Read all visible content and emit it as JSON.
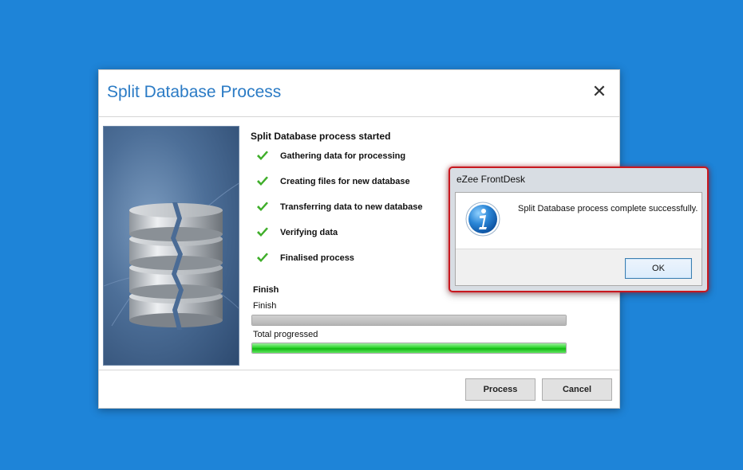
{
  "dialog": {
    "title": "Split Database Process",
    "close_glyph": "✕",
    "steps_header": "Split Database process started",
    "steps": [
      {
        "label": "Gathering data for processing",
        "icon": "check-icon"
      },
      {
        "label": "Creating files for new database",
        "icon": "check-icon"
      },
      {
        "label": "Transferring data to new database",
        "icon": "check-icon"
      },
      {
        "label": "Verifying data",
        "icon": "check-icon"
      },
      {
        "label": "Finalised process",
        "icon": "check-icon"
      }
    ],
    "finish_header": "Finish",
    "progress": [
      {
        "label": "Finish",
        "value": 1.0,
        "color": "gray"
      },
      {
        "label": "Total progressed",
        "value": 1.0,
        "color": "green"
      }
    ],
    "buttons": {
      "process": "Process",
      "cancel": "Cancel"
    }
  },
  "message_box": {
    "title": "eZee FrontDesk",
    "message": "Split Database process complete successfully.",
    "icon": "info-icon",
    "ok": "OK"
  },
  "colors": {
    "desktop": "#1e84d8",
    "title_text": "#2b7bc5",
    "check": "#3fae2a",
    "alert_border": "#c8181f"
  }
}
